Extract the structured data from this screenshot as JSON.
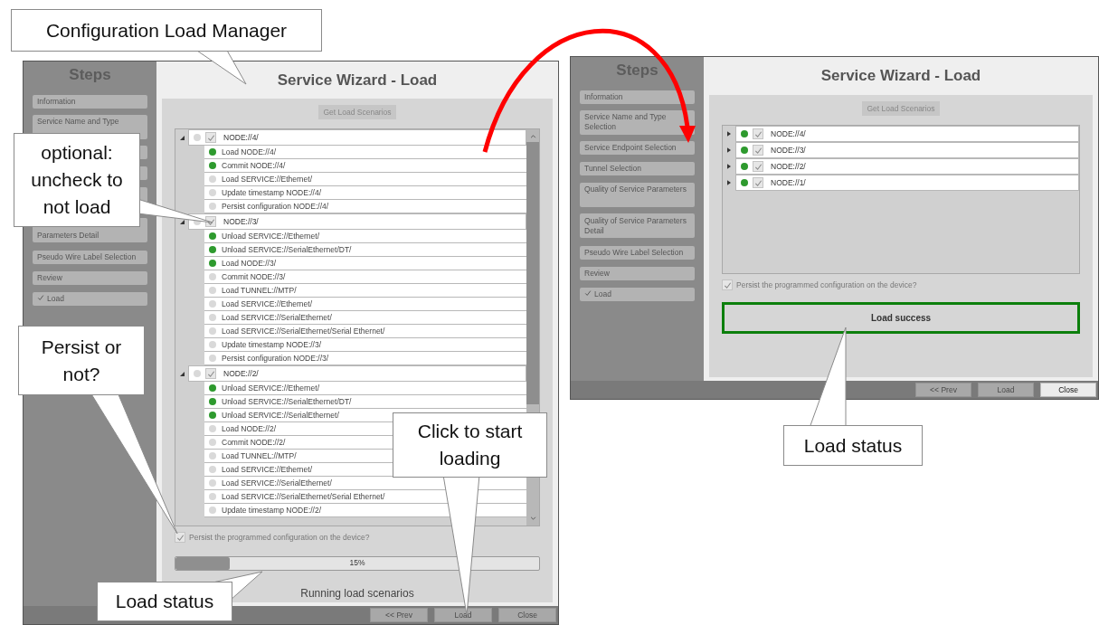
{
  "windows": [
    {
      "steps_title": "Steps",
      "steps": [
        {
          "kind": "step",
          "label": "Information",
          "checked": false
        },
        {
          "kind": "step",
          "label": "Service Name and Type",
          "checked": false
        },
        {
          "kind": "covered"
        },
        {
          "kind": "covered"
        },
        {
          "kind": "covered"
        },
        {
          "kind": "step",
          "label": "Parameters Detail",
          "checked": false
        },
        {
          "kind": "step",
          "label": "Pseudo Wire Label Selection",
          "checked": false
        },
        {
          "kind": "step",
          "label": "Review",
          "checked": false
        },
        {
          "kind": "step",
          "label": "Load",
          "checked": true
        }
      ],
      "title": "Service Wizard - Load",
      "get_button": "Get Load Scenarios",
      "tree": [
        {
          "label": "NODE://4/",
          "expanded": true,
          "done": false,
          "checked": true,
          "children": [
            {
              "label": "Load NODE://4/",
              "done": true
            },
            {
              "label": "Commit NODE://4/",
              "done": true
            },
            {
              "label": "Load SERVICE://Ethernet/",
              "done": false
            },
            {
              "label": "Update timestamp NODE://4/",
              "done": false
            },
            {
              "label": "Persist configuration NODE://4/",
              "done": false
            }
          ]
        },
        {
          "label": "NODE://3/",
          "expanded": true,
          "done": false,
          "checked": true,
          "children": [
            {
              "label": "Unload SERVICE://Ethernet/",
              "done": true
            },
            {
              "label": "Unload SERVICE://SerialEthernet/DT/",
              "done": true
            },
            {
              "label": "Load NODE://3/",
              "done": true
            },
            {
              "label": "Commit NODE://3/",
              "done": false
            },
            {
              "label": "Load TUNNEL://MTP/",
              "done": false
            },
            {
              "label": "Load SERVICE://Ethernet/",
              "done": false
            },
            {
              "label": "Load SERVICE://SerialEthernet/",
              "done": false
            },
            {
              "label": "Load SERVICE://SerialEthernet/Serial Ethernet/",
              "done": false
            },
            {
              "label": "Update timestamp NODE://3/",
              "done": false
            },
            {
              "label": "Persist configuration NODE://3/",
              "done": false
            }
          ]
        },
        {
          "label": "NODE://2/",
          "expanded": true,
          "done": false,
          "checked": true,
          "children": [
            {
              "label": "Unload SERVICE://Ethernet/",
              "done": true
            },
            {
              "label": "Unload SERVICE://SerialEthernet/DT/",
              "done": true
            },
            {
              "label": "Unload SERVICE://SerialEthernet/",
              "done": true
            },
            {
              "label": "Load NODE://2/",
              "done": false
            },
            {
              "label": "Commit NODE://2/",
              "done": false
            },
            {
              "label": "Load TUNNEL://MTP/",
              "done": false
            },
            {
              "label": "Load SERVICE://Ethernet/",
              "done": false
            },
            {
              "label": "Load SERVICE://SerialEthernet/",
              "done": false
            },
            {
              "label": "Load SERVICE://SerialEthernet/Serial Ethernet/",
              "done": false
            },
            {
              "label": "Update timestamp NODE://2/",
              "done": false
            }
          ]
        }
      ],
      "persist": {
        "label": "Persist the programmed configuration on the device?",
        "checked": true
      },
      "progress": {
        "level": 0.15,
        "label": "15%"
      },
      "status_text": "Running load scenarios",
      "buttons": [
        {
          "label": "<< Prev",
          "disabled": true
        },
        {
          "label": "Load",
          "disabled": true
        },
        {
          "label": "Close",
          "disabled": true
        }
      ]
    },
    {
      "steps_title": "Steps",
      "steps": [
        {
          "kind": "step",
          "label": "Information",
          "checked": false
        },
        {
          "kind": "step",
          "label": "Service Name and Type Selection",
          "checked": false
        },
        {
          "kind": "step",
          "label": "Service Endpoint Selection",
          "checked": false
        },
        {
          "kind": "step",
          "label": "Tunnel Selection",
          "checked": false
        },
        {
          "kind": "step",
          "label": "Quality of Service Parameters",
          "checked": false
        },
        {
          "kind": "step",
          "label": "Quality of Service Parameters Detail",
          "checked": false
        },
        {
          "kind": "step",
          "label": "Pseudo Wire Label Selection",
          "checked": false
        },
        {
          "kind": "step",
          "label": "Review",
          "checked": false
        },
        {
          "kind": "step",
          "label": "Load",
          "checked": true
        }
      ],
      "title": "Service Wizard - Load",
      "get_button": "Get Load Scenarios",
      "tree": [
        {
          "label": "NODE://4/",
          "expanded": false,
          "done": true,
          "checked": true
        },
        {
          "label": "NODE://3/",
          "expanded": false,
          "done": true,
          "checked": true
        },
        {
          "label": "NODE://2/",
          "expanded": false,
          "done": true,
          "checked": true
        },
        {
          "label": "NODE://1/",
          "expanded": false,
          "done": true,
          "checked": true
        }
      ],
      "persist": {
        "label": "Persist the programmed configuration on the device?",
        "checked": true
      },
      "result": {
        "text": "Load success",
        "success": true
      },
      "buttons": [
        {
          "label": "<< Prev",
          "disabled": true
        },
        {
          "label": "Load",
          "disabled": true
        },
        {
          "label": "Close",
          "disabled": false
        }
      ]
    }
  ],
  "callouts": [
    {
      "text": "Configuration Load Manager"
    },
    {
      "text": "optional: uncheck to not load"
    },
    {
      "text": "Persist or not?"
    },
    {
      "text": "Load status"
    },
    {
      "text": "Click to start loading"
    },
    {
      "text": "Load status"
    }
  ]
}
